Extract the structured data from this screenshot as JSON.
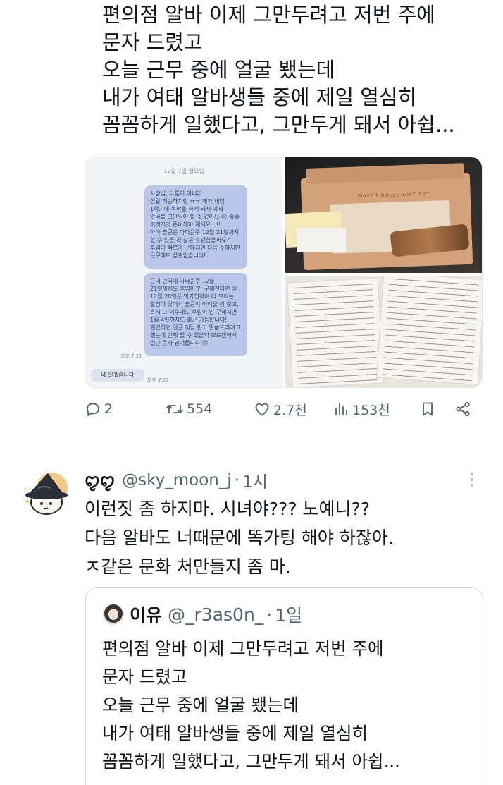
{
  "tweet": {
    "text_lines": [
      "편의점 알바 이제 그만두려고 저번 주에",
      "문자 드렸고",
      "오늘 근무 중에 얼굴 뵀는데",
      "내가 여태 알바생들 중에 제일 열심히",
      "꼼꼼하게 일했다고, 그만두게 돼서 아쉽..."
    ],
    "media": {
      "message_date": "12월 7일 일요일",
      "bubble1_lines": [
        "사장님, 다름이 아니라",
        "정말 죄송하지만 ㅠㅠ 제가 내년",
        "1학기에 복학을 하게 돼서 이제",
        "알바를 그만둬야 할 것 같아요 😢 술술",
        "이것저것 준비해야 해서요...!!",
        "아마 출근은 다다음주 12월 21일까지",
        "할 수 있을 것 같은데 괜찮을까요?",
        "후임이 빠르게 구해지면 다음 주까지만",
        "근무해도 상관없습니다!"
      ],
      "bubble2_lines": [
        "근데 만약에 다다음주 12월",
        "21일까지도 후임이 안 구해진다면 😢",
        "12월 28일은 일가친척이 다 모이는",
        "일정이 있어서 출근이 어려울 것 같고,",
        "혹시 그 이후에도 후임이 안 구해지면",
        "1월 4일까지도 출근 가능합니다!",
        "웬만하면 얼굴 직접 뵙고 말씀드리려고",
        "했는데 언제 뵐 수 있을지 모르겠어서",
        "일단 문자 남겨둡니다 😢"
      ],
      "time1": "오후 7:21",
      "reply_text": "네 알겠습니다",
      "time2": "오후 7:22",
      "box_label": "WAFER ROLLS GIFT SET"
    },
    "actions": {
      "replies": "2",
      "retweets": "554",
      "likes": "2.7천",
      "views": "153천"
    }
  },
  "reply": {
    "name": "ꨄꨄ",
    "handle": "@sky_moon_j",
    "dot": "·",
    "ago": "1시",
    "text_lines": [
      "이런짓 좀 하지마. 시녀야??? 노예니??",
      "다음 알바도 너때문에 똑가팅 해야 하잖아.",
      "ㅈ같은 문화 처만들지 좀 마."
    ],
    "quote": {
      "name": "이유",
      "handle": "@_r3as0n_",
      "dot": "·",
      "ago": "1일",
      "text_lines": [
        "편의점 알바 이제 그만두려고 저번 주에",
        "문자 드렸고",
        "오늘 근무 중에 얼굴 뵀는데",
        "내가 여태 알바생들 중에 제일 열심히",
        "꼼꼼하게 일했다고, 그만두게 돼서 아쉽..."
      ]
    }
  },
  "colors": {
    "text": "#0f1419",
    "secondary": "#536471",
    "border": "#cfd9de",
    "bubble": "#b9c7ea"
  },
  "icons": [
    "reply-icon",
    "retweet-icon",
    "like-icon",
    "views-icon",
    "bookmark-icon",
    "share-icon",
    "more-icon"
  ]
}
